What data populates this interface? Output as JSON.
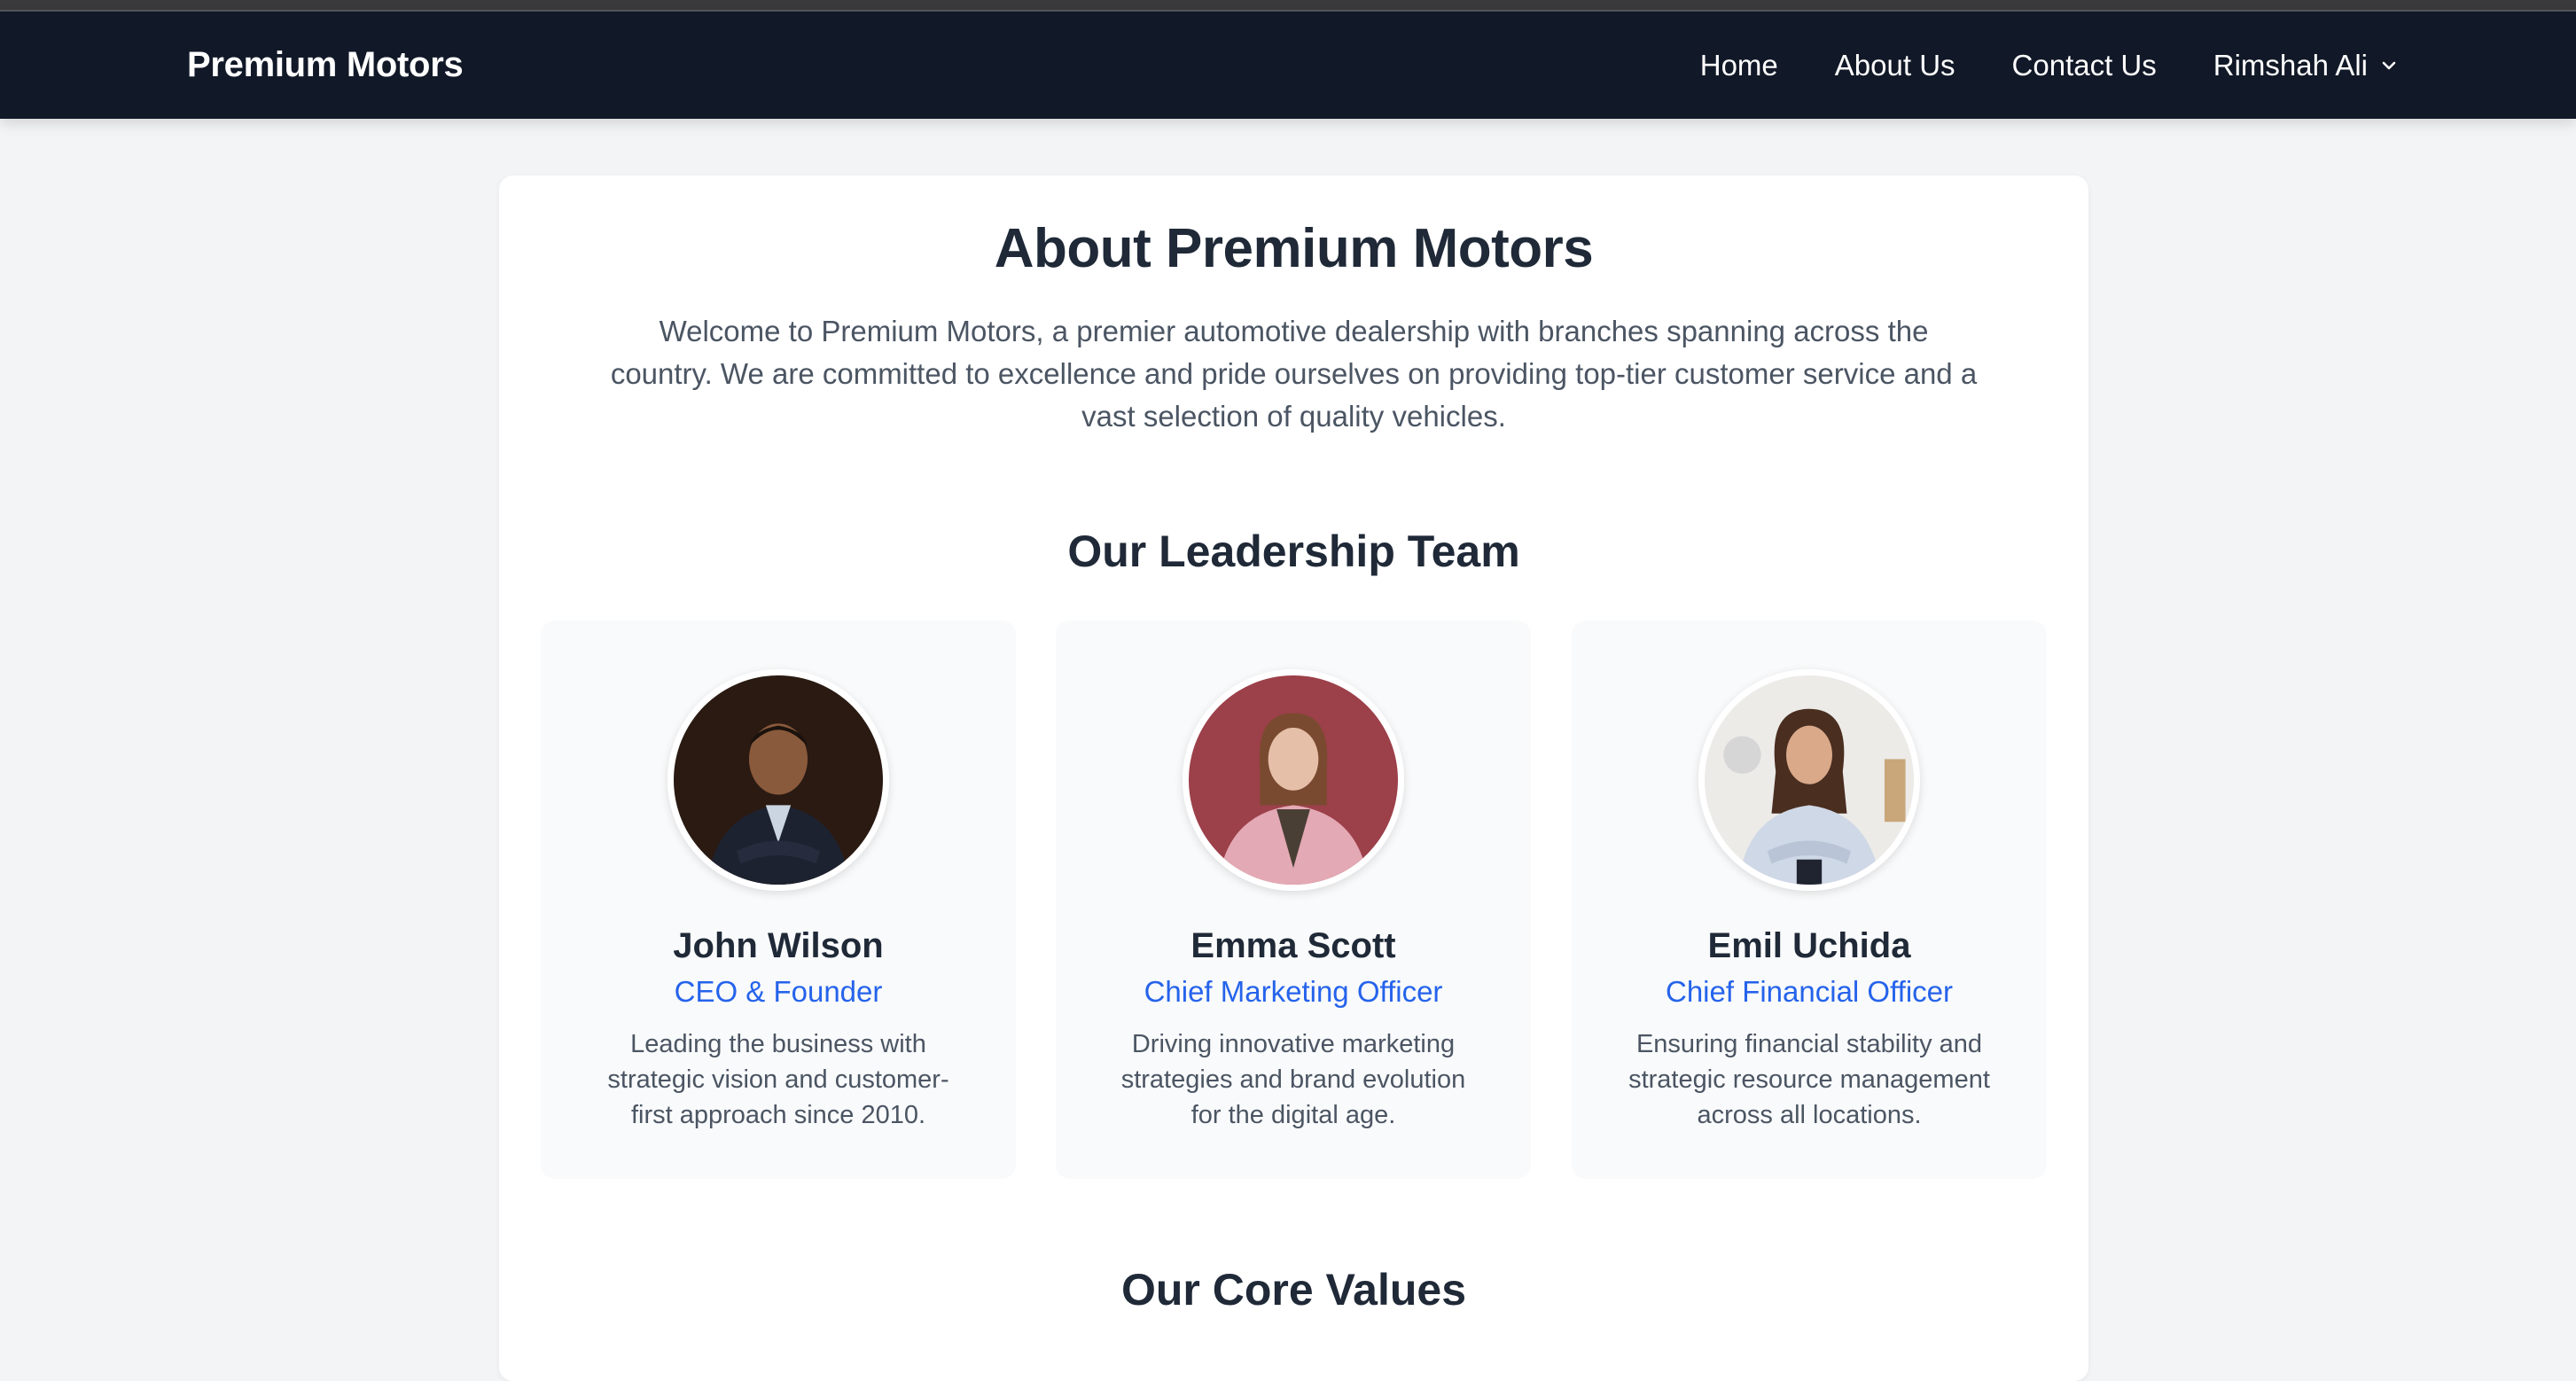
{
  "navbar": {
    "brand": "Premium Motors",
    "links": [
      "Home",
      "About Us",
      "Contact Us"
    ],
    "user_menu": "Rimshah Ali"
  },
  "about": {
    "title": "About Premium Motors",
    "intro": "Welcome to Premium Motors, a premier automotive dealership with branches spanning across the country. We are committed to excellence and pride ourselves on providing top-tier customer service and a vast selection of quality vehicles."
  },
  "leadership": {
    "title": "Our Leadership Team",
    "members": [
      {
        "name": "John Wilson",
        "role": "CEO & Founder",
        "description": "Leading the business with strategic vision and customer-first approach since 2010."
      },
      {
        "name": "Emma Scott",
        "role": "Chief Marketing Officer",
        "description": "Driving innovative marketing strategies and brand evolution for the digital age."
      },
      {
        "name": "Emil Uchida",
        "role": "Chief Financial Officer",
        "description": "Ensuring financial stability and strategic resource management across all locations."
      }
    ]
  },
  "values": {
    "title": "Our Core Values"
  },
  "colors": {
    "navbar_bg": "#111827",
    "page_bg": "#f3f4f6",
    "accent": "#2563eb",
    "heading": "#1f2937",
    "body_text": "#4b5563"
  }
}
